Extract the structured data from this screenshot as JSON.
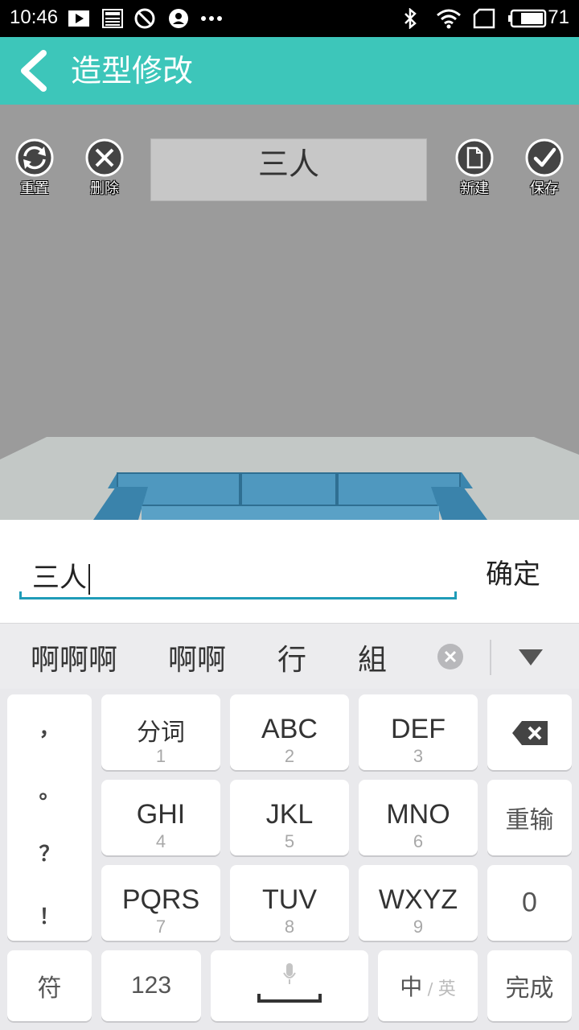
{
  "status_bar": {
    "time": "10:46",
    "battery": "71"
  },
  "app": {
    "title": "造型修改"
  },
  "toolbar": {
    "reset_label": "重置",
    "delete_label": "删除",
    "new_label": "新建",
    "save_label": "保存",
    "name_value": "三人"
  },
  "input": {
    "value": "三人",
    "confirm_label": "确定"
  },
  "candidates": [
    "啊啊啊",
    "啊啊",
    "行",
    "組"
  ],
  "keyboard": {
    "punctuation": [
      "，",
      "。",
      "？",
      "！"
    ],
    "keys": [
      {
        "main": "分词",
        "sub": "1"
      },
      {
        "main": "ABC",
        "sub": "2"
      },
      {
        "main": "DEF",
        "sub": "3"
      },
      {
        "main": "GHI",
        "sub": "4"
      },
      {
        "main": "JKL",
        "sub": "5"
      },
      {
        "main": "MNO",
        "sub": "6"
      },
      {
        "main": "PQRS",
        "sub": "7"
      },
      {
        "main": "TUV",
        "sub": "8"
      },
      {
        "main": "WXYZ",
        "sub": "9"
      }
    ],
    "retype_label": "重输",
    "zero_label": "0",
    "symbol_label": "符",
    "num_label": "123",
    "lang_main": "中",
    "lang_sep": "/",
    "lang_alt": "英",
    "done_label": "完成"
  }
}
